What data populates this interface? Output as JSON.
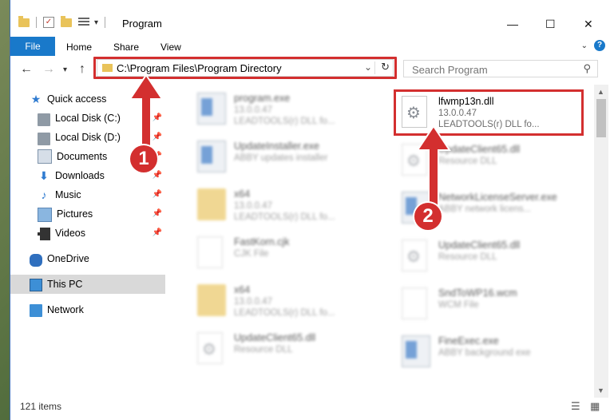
{
  "window": {
    "title": "Program",
    "controls": {
      "minimize": "—",
      "maximize": "☐",
      "close": "✕"
    }
  },
  "ribbon": {
    "tabs": [
      "File",
      "Home",
      "Share",
      "View"
    ],
    "help": "?"
  },
  "nav": {
    "address": "C:\\Program Files\\Program Directory",
    "search_placeholder": "Search Program"
  },
  "sidebar": {
    "items": [
      {
        "label": "Quick access",
        "icon": "star-icon"
      },
      {
        "label": "Local Disk (C:)",
        "icon": "disk-icon",
        "pinned": true
      },
      {
        "label": "Local Disk (D:)",
        "icon": "disk-icon",
        "pinned": true
      },
      {
        "label": "Documents",
        "icon": "documents-icon",
        "pinned": true
      },
      {
        "label": "Downloads",
        "icon": "download-icon",
        "pinned": true
      },
      {
        "label": "Music",
        "icon": "music-icon",
        "pinned": true
      },
      {
        "label": "Pictures",
        "icon": "pictures-icon",
        "pinned": true
      },
      {
        "label": "Videos",
        "icon": "videos-icon",
        "pinned": true
      },
      {
        "label": "OneDrive",
        "icon": "cloud-icon"
      },
      {
        "label": "This PC",
        "icon": "pc-icon",
        "selected": true
      },
      {
        "label": "Network",
        "icon": "network-icon"
      }
    ]
  },
  "files": {
    "left": [
      {
        "name": "program.exe",
        "sub1": "13.0.0.47",
        "sub2": "LEADTOOLS(r) DLL fo...",
        "icon": "exe"
      },
      {
        "name": "UpdateInstaller.exe",
        "sub1": "ABBY updates installer",
        "sub2": "",
        "icon": "exe"
      },
      {
        "name": "x64",
        "sub1": "13.0.0.47",
        "sub2": "LEADTOOLS(r) DLL fo...",
        "icon": "folder"
      },
      {
        "name": "FastKorn.cjk",
        "sub1": "CJK File",
        "sub2": "",
        "icon": "page"
      },
      {
        "name": "x64",
        "sub1": "13.0.0.47",
        "sub2": "LEADTOOLS(r) DLL fo...",
        "icon": "folder"
      },
      {
        "name": "UpdateClient65.dll",
        "sub1": "Resource DLL",
        "sub2": "",
        "icon": "gear"
      }
    ],
    "right": [
      {
        "name": "lfwmp13n.dll",
        "sub1": "13.0.0.47",
        "sub2": "LEADTOOLS(r) DLL fo...",
        "icon": "gear"
      },
      {
        "name": "UpdateClient65.dll",
        "sub1": "Resource DLL",
        "sub2": "",
        "icon": "gear"
      },
      {
        "name": "NetworkLicenseServer.exe",
        "sub1": "ABBY network licens...",
        "sub2": "",
        "icon": "exe"
      },
      {
        "name": "UpdateClient65.dll",
        "sub1": "Resource DLL",
        "sub2": "",
        "icon": "gear"
      },
      {
        "name": "SndToWP16.wcm",
        "sub1": "WCM File",
        "sub2": "",
        "icon": "page"
      },
      {
        "name": "FineExec.exe",
        "sub1": "ABBY background exe",
        "sub2": "",
        "icon": "exe"
      }
    ]
  },
  "status": {
    "count": "121 items"
  },
  "annotations": {
    "step1": "1",
    "step2": "2"
  }
}
